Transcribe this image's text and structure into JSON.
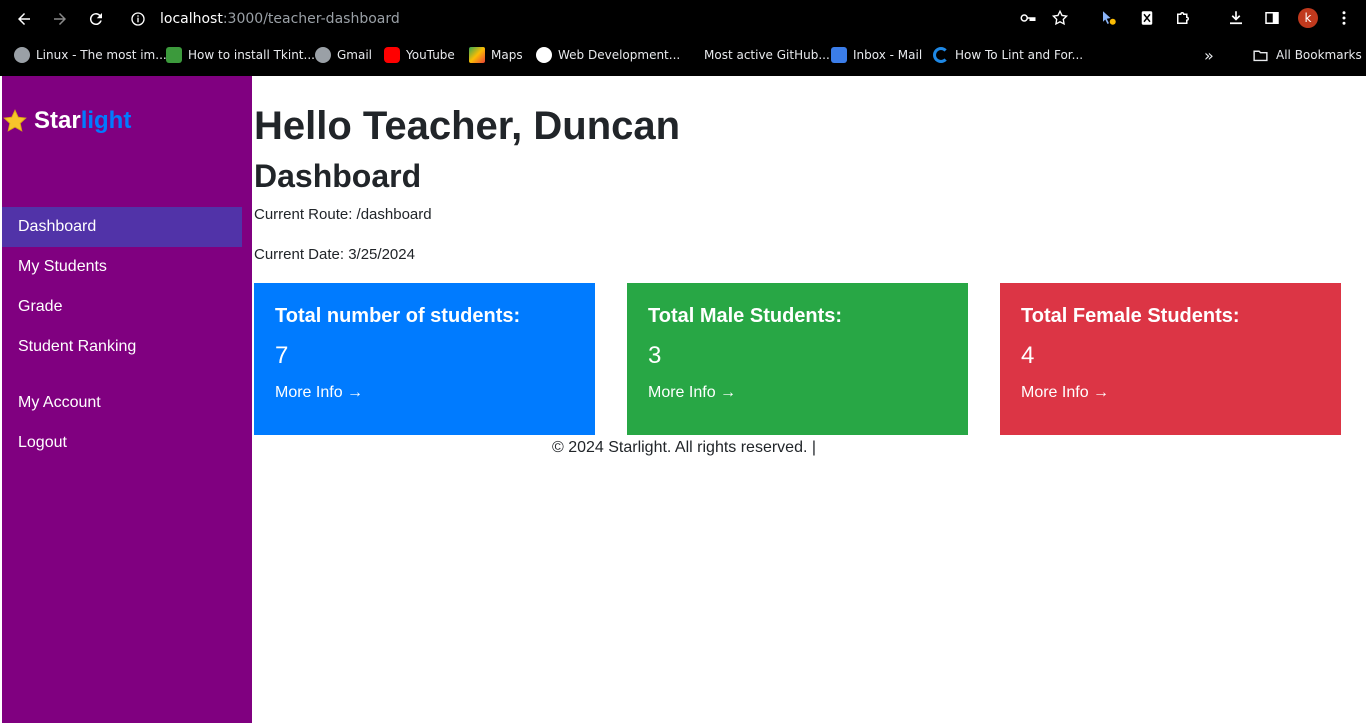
{
  "browser": {
    "url_host": "localhost",
    "url_path": ":3000/teacher-dashboard",
    "profile_initial": "k",
    "bookmarks": [
      {
        "label": "Linux - The most im...",
        "icon": "globe-icon"
      },
      {
        "label": "How to install Tkint...",
        "icon": "green-page-icon"
      },
      {
        "label": "Gmail",
        "icon": "globe-icon"
      },
      {
        "label": "YouTube",
        "icon": "youtube-icon"
      },
      {
        "label": "Maps",
        "icon": "maps-icon"
      },
      {
        "label": "Web Development...",
        "icon": "circle-icon"
      },
      {
        "label": "Most active GitHub...",
        "icon": "blank-icon"
      },
      {
        "label": "Inbox - Mail",
        "icon": "mail-icon"
      },
      {
        "label": "How To Lint and For...",
        "icon": "spinner-icon"
      }
    ],
    "all_bookmarks_label": "All Bookmarks",
    "overflow_label": "»"
  },
  "sidebar": {
    "brand_part1": "Star",
    "brand_part2": "light",
    "items": [
      {
        "label": "Dashboard",
        "active": true
      },
      {
        "label": "My Students"
      },
      {
        "label": "Grade"
      },
      {
        "label": "Student Ranking"
      }
    ],
    "account_items": [
      {
        "label": "My Account"
      },
      {
        "label": "Logout"
      }
    ]
  },
  "main": {
    "greeting": "Hello Teacher, Duncan",
    "title": "Dashboard",
    "route": "Current Route: /dashboard",
    "date": "Current Date: 3/25/2024",
    "cards": [
      {
        "title": "Total number of students:",
        "value": "7",
        "link": "More Info →",
        "color": "#007bff"
      },
      {
        "title": "Total Male Students:",
        "value": "3",
        "link": "More Info →",
        "color": "#28a745"
      },
      {
        "title": "Total Female Students:",
        "value": "4",
        "link": "More Info →",
        "color": "#dc3545"
      }
    ],
    "footer": "© 2024 Starlight. All rights reserved. |"
  },
  "colors": {
    "sidebar_bg": "#800080",
    "active_item_bg": "#5133a8",
    "brand_accent": "#007bff"
  }
}
